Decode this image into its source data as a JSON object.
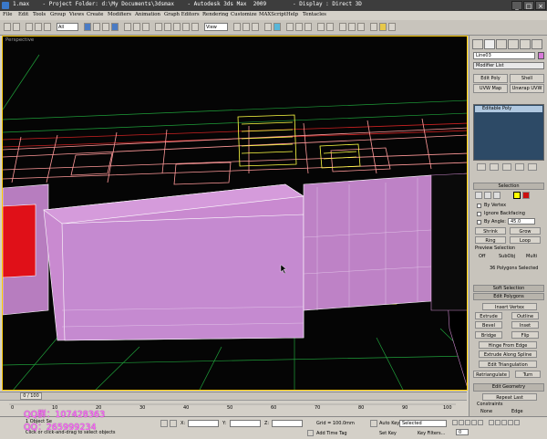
{
  "window": {
    "title": "1.max    - Project Folder: d:\\My Documents\\3dsmax    - Autodesk 3ds Max  2009        - Display : Direct 3D",
    "minimize_icon": "minimize-icon",
    "maximize_icon": "maximize-icon",
    "close_icon": "close-icon"
  },
  "menu": [
    "File",
    "Edit",
    "Tools",
    "Group",
    "Views",
    "Create",
    "Modifiers",
    "Animation",
    "Graph Editors",
    "Rendering",
    "Customize",
    "MAXScript",
    "Help",
    "Tentacles"
  ],
  "toolbar": {
    "selection_filter": "All",
    "reference_coord": "View"
  },
  "viewport": {
    "label": "Perspective"
  },
  "panel": {
    "object_name": "Line03",
    "object_color": "#d87ad8",
    "modifier_list": "Modifier List",
    "mod_buttons": [
      "Edit Poly",
      "Shell",
      "UVW Map",
      "Unwrap UVW"
    ],
    "stack_items": [
      "Editable Poly"
    ],
    "selection_rollout": "Selection",
    "by_vertex": "By Vertex",
    "ignore_backfacing": "Ignore Backfacing",
    "by_angle": "By Angle:",
    "by_angle_value": "45.0",
    "shrink": "Shrink",
    "grow": "Grow",
    "ring": "Ring",
    "loop": "Loop",
    "preview_selection": "Preview Selection",
    "preview_off": "Off",
    "preview_subobj": "SubObj",
    "preview_multi": "Multi",
    "selected_info": "36 Polygons Selected",
    "soft_selection": "Soft Selection",
    "edit_polygons": "Edit Polygons",
    "insert_vertex": "Insert Vertex",
    "extrude": "Extrude",
    "outline": "Outline",
    "bevel": "Bevel",
    "inset": "Inset",
    "bridge": "Bridge",
    "flip": "Flip",
    "hinge_from_edge": "Hinge From Edge",
    "extrude_along_spline": "Extrude Along Spline",
    "edit_triangulation": "Edit Triangulation",
    "retriangulate": "Retriangulate",
    "turn": "Turn",
    "edit_geometry": "Edit Geometry",
    "repeat_last": "Repeat Last",
    "constraints": "Constraints",
    "constraint_none": "None",
    "constraint_edge": "Edge"
  },
  "timeline": {
    "frame_label": "0 / 100",
    "ticks": [
      "0",
      "10",
      "20",
      "30",
      "40",
      "50",
      "60",
      "70",
      "80",
      "90",
      "100"
    ]
  },
  "status": {
    "line1": "1 Object Se",
    "line2": "Click or click-and-drag to select objects",
    "x_label": "X:",
    "y_label": "Y:",
    "z_label": "Z:",
    "grid": "Grid = 100.0mm",
    "add_time_tag": "Add Time Tag",
    "auto_key": "Auto Key",
    "set_key": "Set Key",
    "selected_dropdown": "Selected",
    "key_filters": "Key Filters...",
    "frame_value": "0"
  },
  "overlay": {
    "qq_line1": "QQ群：107428363",
    "qq_line2": "QQ：265999234",
    "color": "#ff55ff"
  },
  "colors": {
    "viewport_bg": "#050505",
    "selected_face": "#c98ad0",
    "red_face": "#e01018",
    "wire_floor": "#ff9999",
    "yellow_wire": "#ffff44",
    "grid_green": "#1fa03a"
  }
}
